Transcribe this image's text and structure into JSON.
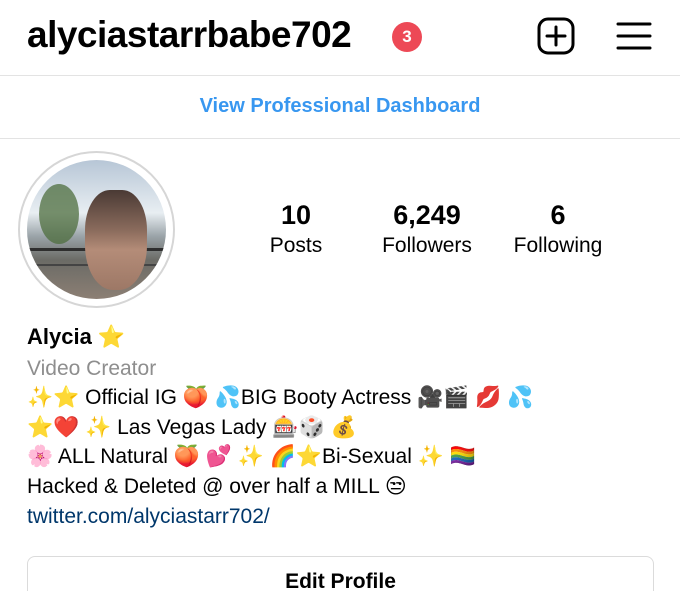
{
  "header": {
    "username": "alyciastarrbabe702",
    "notification_count": "3",
    "add_icon": "plus-square-icon",
    "menu_icon": "hamburger-menu-icon"
  },
  "dashboard": {
    "label": "View Professional Dashboard"
  },
  "profile": {
    "avatar": "profile-photo",
    "stats": [
      {
        "value": "10",
        "label": "Posts"
      },
      {
        "value": "6,249",
        "label": "Followers"
      },
      {
        "value": "6",
        "label": "Following"
      }
    ],
    "name": "Alycia ⭐",
    "category": "Video Creator",
    "bio": [
      "✨⭐ Official IG 🍑 💦BIG Booty Actress 🎥🎬 💋 💦",
      "⭐❤️ ✨ Las Vegas Lady 🎰🎲 💰",
      "🌸 ALL Natural 🍑 💕 ✨ 🌈⭐Bi-Sexual ✨ 🏳️‍🌈",
      "Hacked & Deleted @ over half a MILL 😒"
    ],
    "link": "twitter.com/alyciastarr702/"
  },
  "actions": {
    "edit_profile": "Edit Profile"
  },
  "colors": {
    "link_blue": "#3897f0",
    "badge_red": "#ed4956",
    "link_dark": "#00376b"
  }
}
